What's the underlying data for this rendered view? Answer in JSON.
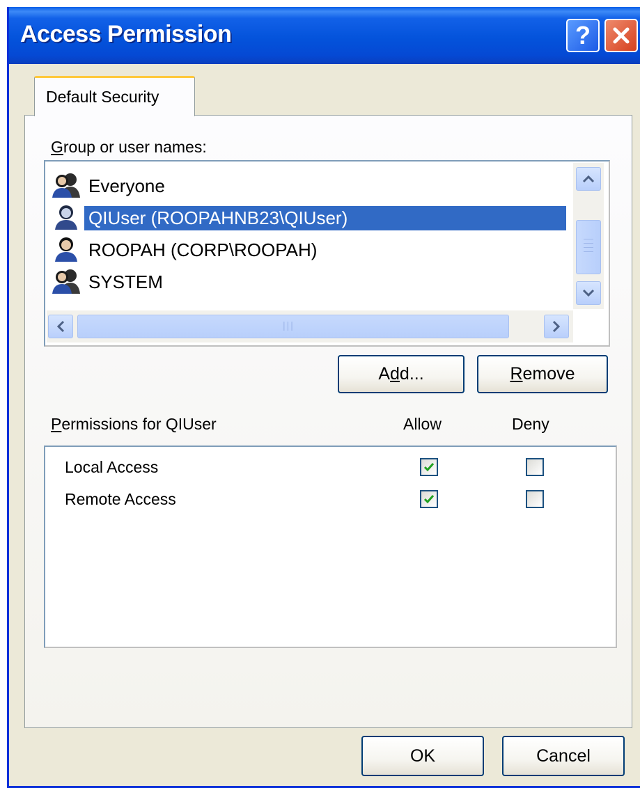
{
  "window": {
    "title": "Access Permission"
  },
  "titlebar": {
    "help_label": "?"
  },
  "tabs": [
    {
      "label": "Default Security",
      "active": true
    }
  ],
  "group_section": {
    "label": "Group or user names:",
    "underline_char": "G",
    "label_rest": "roup or user names:"
  },
  "users": [
    {
      "name": "Everyone",
      "icon": "user-group-icon",
      "selected": false
    },
    {
      "name": "QIUser (ROOPAHNB23\\QIUser)",
      "icon": "user-icon",
      "selected": true
    },
    {
      "name": "ROOPAH (CORP\\ROOPAH)",
      "icon": "user-icon",
      "selected": false
    },
    {
      "name": "SYSTEM",
      "icon": "user-group-icon",
      "selected": false
    }
  ],
  "buttons": {
    "add": {
      "pre": "A",
      "accel": "d",
      "post": "d..."
    },
    "remove": {
      "pre": "",
      "accel": "R",
      "post": "emove"
    },
    "ok": "OK",
    "cancel": "Cancel"
  },
  "permissions": {
    "label_accel": "P",
    "label_rest": "ermissions for QIUser",
    "allow_header": "Allow",
    "deny_header": "Deny",
    "rows": [
      {
        "name": "Local Access",
        "allow": true,
        "deny": false
      },
      {
        "name": "Remote Access",
        "allow": true,
        "deny": false
      }
    ]
  },
  "colors": {
    "titlebar": "#0453db",
    "selection": "#316ac5",
    "dialog_bg": "#ece9d8",
    "check": "#21a121"
  }
}
